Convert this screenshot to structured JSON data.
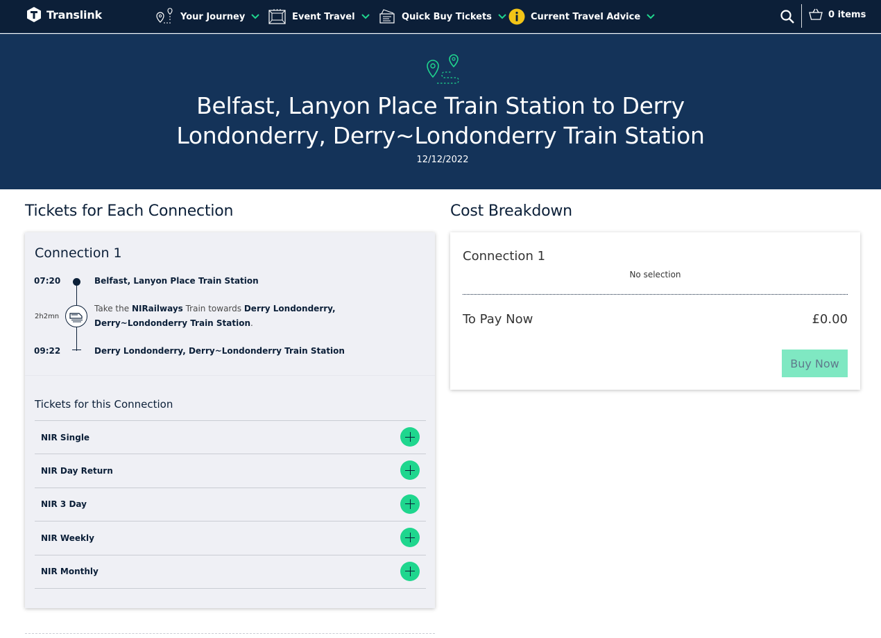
{
  "brand": {
    "name": "Translink"
  },
  "nav": {
    "items": [
      {
        "label": "Your Journey",
        "icon": "map-pin-route-icon"
      },
      {
        "label": "Event Travel",
        "icon": "stadium-icon"
      },
      {
        "label": "Quick Buy Tickets",
        "icon": "tickets-icon"
      },
      {
        "label": "Current Travel Advice",
        "icon": "info-icon"
      }
    ],
    "basket_label": "0 items"
  },
  "hero": {
    "title": "Belfast, Lanyon Place Train Station to Derry Londonderry, Derry~Londonderry Train Station",
    "date": "12/12/2022"
  },
  "tickets_section": {
    "title": "Tickets for Each Connection",
    "connection": {
      "label": "Connection 1",
      "depart_time": "07:20",
      "depart_stop": "Belfast, Lanyon Place Train Station",
      "duration": "2h2mn",
      "leg": {
        "prefix": "Take the ",
        "operator": "NIRailways",
        "middle": " Train towards ",
        "destination": "Derry Londonderry, Derry~Londonderry Train Station",
        "suffix": "."
      },
      "arrive_time": "09:22",
      "arrive_stop": "Derry Londonderry, Derry~Londonderry Train Station"
    },
    "tickets_header": "Tickets for this Connection",
    "tickets": [
      {
        "name": "NIR Single"
      },
      {
        "name": "NIR Day Return"
      },
      {
        "name": "NIR 3 Day"
      },
      {
        "name": "NIR Weekly"
      },
      {
        "name": "NIR Monthly"
      }
    ]
  },
  "cost_section": {
    "title": "Cost Breakdown",
    "connection_label": "Connection 1",
    "selection_text": "No selection",
    "pay_label": "To Pay Now",
    "total": "£0.00",
    "buy_label": "Buy Now"
  },
  "colors": {
    "nav_bg": "#0c1f38",
    "hero_bg": "#143359",
    "accent": "#1fd68e",
    "buy_disabled": "#7fe8c2",
    "info_yellow": "#f2c417"
  }
}
